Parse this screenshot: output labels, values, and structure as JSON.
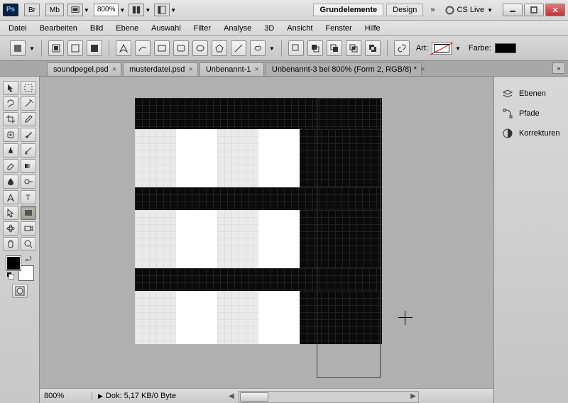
{
  "app": {
    "logo_text": "Ps",
    "br_box": "Br",
    "mb_box": "Mb"
  },
  "titlebar": {
    "zoom": "800%",
    "ws1": "Grundelemente",
    "ws2": "Design",
    "cslive": "CS Live"
  },
  "menu": {
    "items": [
      "Datei",
      "Bearbeiten",
      "Bild",
      "Ebene",
      "Auswahl",
      "Filter",
      "Analyse",
      "3D",
      "Ansicht",
      "Fenster",
      "Hilfe"
    ]
  },
  "options": {
    "art_label": "Art:",
    "color_label": "Farbe:"
  },
  "tabs": [
    {
      "label": "soundpegel.psd",
      "active": false
    },
    {
      "label": "musterdatei.psd",
      "active": false
    },
    {
      "label": "Unbenannt-1",
      "active": false
    },
    {
      "label": "Unbenannt-3 bei 800% (Form 2, RGB/8) *",
      "active": true
    }
  ],
  "status": {
    "zoom": "800%",
    "doc_info": "Dok: 5,17 KB/0 Byte"
  },
  "panels": {
    "layers": "Ebenen",
    "paths": "Pfade",
    "adjustments": "Korrekturen"
  }
}
